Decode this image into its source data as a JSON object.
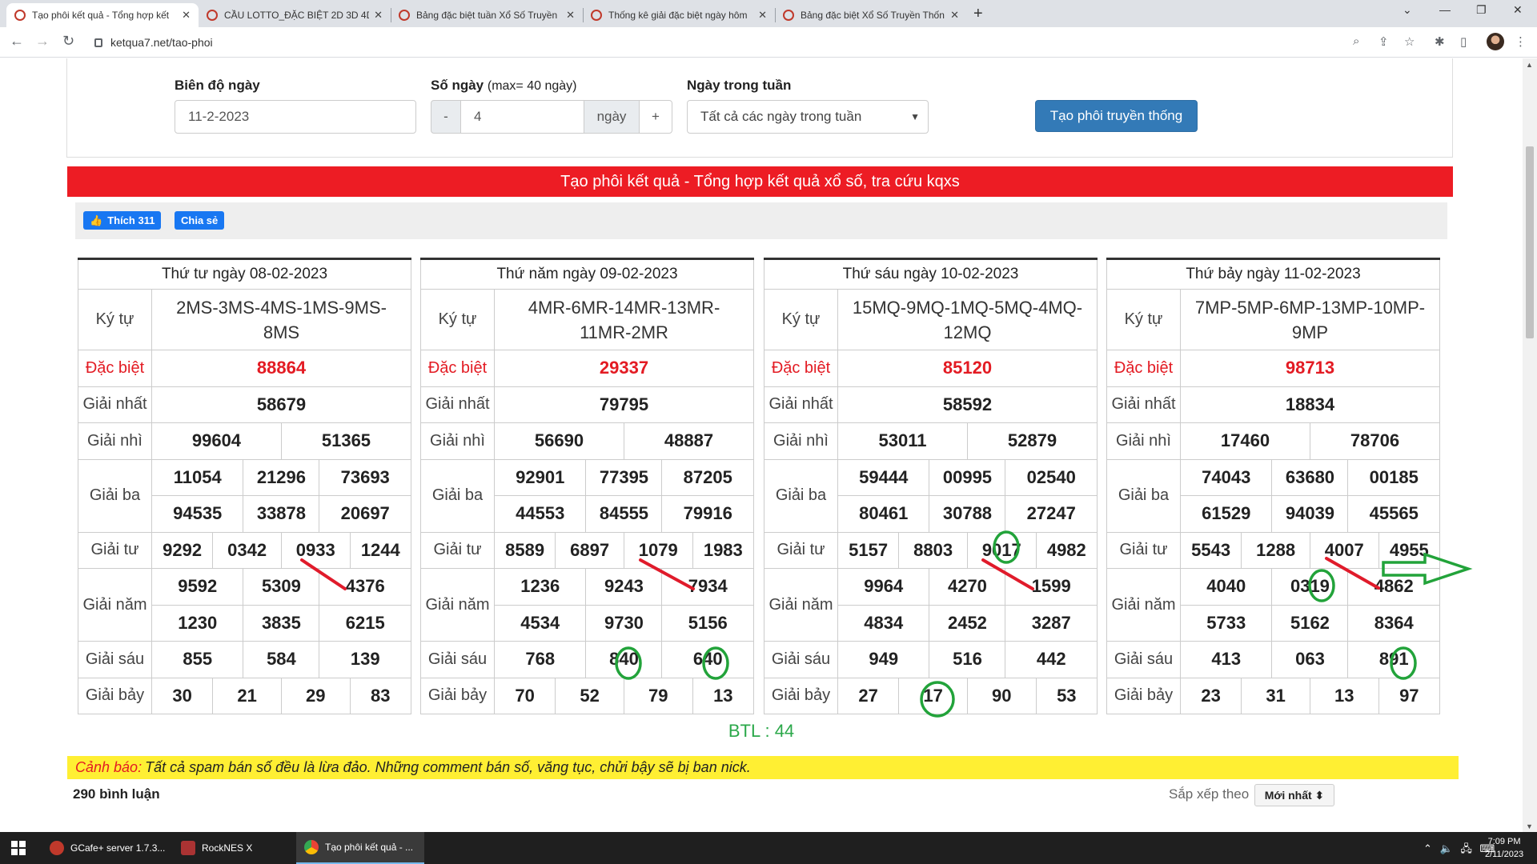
{
  "browser": {
    "tabs": [
      {
        "title": "Tạo phôi kết quả - Tổng hợp kết"
      },
      {
        "title": "CẦU LOTTO_ĐẶC BIỆT 2D 3D 4D"
      },
      {
        "title": "Bảng đặc biệt tuần Xổ Số Truyền"
      },
      {
        "title": "Thống kê giải đặc biệt ngày hôm"
      },
      {
        "title": "Bảng đặc biệt Xổ Số Truyền Thốn"
      }
    ],
    "url": "ketqua7.net/tao-phoi"
  },
  "form": {
    "range_label": "Biên độ ngày",
    "range_value": "11-2-2023",
    "days_label": "Số ngày",
    "days_note": "(max= 40 ngày)",
    "minus": "-",
    "days_value": "4",
    "days_unit": "ngày",
    "plus": "+",
    "weekday_label": "Ngày trong tuần",
    "weekday_value": "Tất cả các ngày trong tuần",
    "generate_button": "Tạo phôi truyền thống"
  },
  "banner": "Tạo phôi kết quả - Tổng hợp kết quả xổ số, tra cứu kqxs",
  "social": {
    "like": "Thích 311",
    "share": "Chia sẻ"
  },
  "labels": {
    "kytu": "Ký tự",
    "db": "Đặc biệt",
    "g1": "Giải nhất",
    "g2": "Giải nhì",
    "g3": "Giải ba",
    "g4": "Giải tư",
    "g5": "Giải năm",
    "g6": "Giải sáu",
    "g7": "Giải bảy"
  },
  "days": [
    {
      "header": "Thứ tư ngày 08-02-2023",
      "kytu": "2MS-3MS-4MS-1MS-9MS-8MS",
      "db": "88864",
      "g1": "58679",
      "g2": [
        "99604",
        "51365"
      ],
      "g3": [
        "11054",
        "21296",
        "73693",
        "94535",
        "33878",
        "20697"
      ],
      "g4": [
        "9292",
        "0342",
        "0933",
        "1244"
      ],
      "g5": [
        "9592",
        "5309",
        "4376",
        "1230",
        "3835",
        "6215"
      ],
      "g6": [
        "855",
        "584",
        "139"
      ],
      "g7": [
        "30",
        "21",
        "29",
        "83"
      ]
    },
    {
      "header": "Thứ năm ngày 09-02-2023",
      "kytu": "4MR-6MR-14MR-13MR-11MR-2MR",
      "db": "29337",
      "g1": "79795",
      "g2": [
        "56690",
        "48887"
      ],
      "g3": [
        "92901",
        "77395",
        "87205",
        "44553",
        "84555",
        "79916"
      ],
      "g4": [
        "8589",
        "6897",
        "1079",
        "1983"
      ],
      "g5": [
        "1236",
        "9243",
        "7934",
        "4534",
        "9730",
        "5156"
      ],
      "g6": [
        "768",
        "840",
        "640"
      ],
      "g7": [
        "70",
        "52",
        "79",
        "13"
      ]
    },
    {
      "header": "Thứ sáu ngày 10-02-2023",
      "kytu": "15MQ-9MQ-1MQ-5MQ-4MQ-12MQ",
      "db": "85120",
      "g1": "58592",
      "g2": [
        "53011",
        "52879"
      ],
      "g3": [
        "59444",
        "00995",
        "02540",
        "80461",
        "30788",
        "27247"
      ],
      "g4": [
        "5157",
        "8803",
        "9017",
        "4982"
      ],
      "g5": [
        "9964",
        "4270",
        "1599",
        "4834",
        "2452",
        "3287"
      ],
      "g6": [
        "949",
        "516",
        "442"
      ],
      "g7": [
        "27",
        "17",
        "90",
        "53"
      ]
    },
    {
      "header": "Thứ bảy ngày 11-02-2023",
      "kytu": "7MP-5MP-6MP-13MP-10MP-9MP",
      "db": "98713",
      "g1": "18834",
      "g2": [
        "17460",
        "78706"
      ],
      "g3": [
        "74043",
        "63680",
        "00185",
        "61529",
        "94039",
        "45565"
      ],
      "g4": [
        "5543",
        "1288",
        "4007",
        "4955"
      ],
      "g5": [
        "4040",
        "0319",
        "4862",
        "5733",
        "5162",
        "8364"
      ],
      "g6": [
        "413",
        "063",
        "891"
      ],
      "g7": [
        "23",
        "31",
        "13",
        "97"
      ]
    }
  ],
  "btl": "BTL : 44",
  "warning": {
    "prefix": "Cảnh báo:",
    "text": "Tất cả spam bán số đều là lừa đảo. Những comment bán số, văng tục, chửi bậy sẽ bị ban nick."
  },
  "comments": {
    "count": "290 bình luận",
    "sort_label": "Sắp xếp theo",
    "sort_value": "Mới nhất ⬍"
  },
  "annotation_colors": {
    "line": "#e01b2b",
    "circle": "#22a33a",
    "arrow": "#22a33a"
  },
  "taskbar": {
    "apps": [
      "GCafe+ server 1.7.3...",
      "RockNES X",
      "Tạo phôi kết quả - ..."
    ],
    "time": "7:09 PM",
    "date": "2/11/2023"
  }
}
